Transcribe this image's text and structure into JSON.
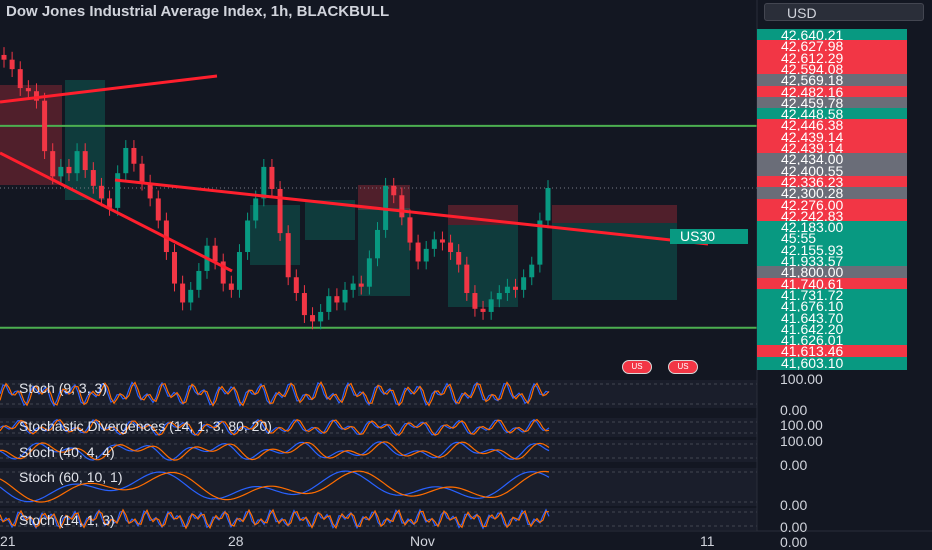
{
  "header": {
    "title": "Dow Jones Industrial Average Index, 1h, BLACKBULL",
    "currency": "USD"
  },
  "colors": {
    "background": "#131722",
    "up": "#089981",
    "down": "#f23645",
    "trendline": "#ff1f2d",
    "level": "#4caf50",
    "grey_tag": "#6a6d78"
  },
  "chart_data": {
    "type": "candlestick",
    "symbol_tag": "US30",
    "countdown": "45:55",
    "x_tick_labels": [
      "21",
      "28",
      "Nov",
      "11"
    ],
    "price_range": [
      41590,
      42700
    ],
    "price_close_series": [
      42590,
      42560,
      42500,
      42490,
      42460,
      42300,
      42220,
      42250,
      42230,
      42300,
      42240,
      42190,
      42150,
      42120,
      42230,
      42310,
      42260,
      42200,
      42150,
      42080,
      41980,
      41880,
      41820,
      41860,
      41920,
      42000,
      41950,
      41880,
      41860,
      41980,
      42080,
      42150,
      42250,
      42180,
      42040,
      41900,
      41850,
      41780,
      41760,
      41790,
      41840,
      41820,
      41860,
      41880,
      41870,
      41960,
      42050,
      42190,
      42160,
      42090,
      42010,
      41950,
      41990,
      42020,
      42010,
      41980,
      41940,
      41850,
      41800,
      41790,
      41830,
      41850,
      41870,
      41860,
      41900,
      41940,
      42080,
      42183
    ],
    "horizontal_levels": [
      42380,
      41740
    ],
    "price_tags": [
      {
        "label": "42,640.21",
        "color": "#089981"
      },
      {
        "label": "42,627.98",
        "color": "#f23645"
      },
      {
        "label": "42,612.29",
        "color": "#f23645"
      },
      {
        "label": "42,594.08",
        "color": "#f23645"
      },
      {
        "label": "42,569.18",
        "color": "#6a6d78"
      },
      {
        "label": "42,482.16",
        "color": "#f23645"
      },
      {
        "label": "42,459.78",
        "color": "#6a6d78"
      },
      {
        "label": "42,448.58",
        "color": "#089981"
      },
      {
        "label": "42,446.38",
        "color": "#f23645"
      },
      {
        "label": "42,439.14",
        "color": "#f23645"
      },
      {
        "label": "42,439.14",
        "color": "#f23645"
      },
      {
        "label": "42,434.00",
        "color": "#6a6d78"
      },
      {
        "label": "42,400.55",
        "color": "#6a6d78"
      },
      {
        "label": "42,336.23",
        "color": "#f23645"
      },
      {
        "label": "42,300.28",
        "color": "#6a6d78"
      },
      {
        "label": "42,276.00",
        "color": "#f23645"
      },
      {
        "label": "42,242.83",
        "color": "#f23645"
      },
      {
        "label": "42,183.00",
        "color": "#089981"
      },
      {
        "label": "45:55",
        "color": "#089981"
      },
      {
        "label": "42,155.93",
        "color": "#089981"
      },
      {
        "label": "41,933.57",
        "color": "#089981"
      },
      {
        "label": "41,800.00",
        "color": "#6a6d78"
      },
      {
        "label": "41,740.61",
        "color": "#f23645"
      },
      {
        "label": "41,731.72",
        "color": "#089981"
      },
      {
        "label": "41,676.10",
        "color": "#089981"
      },
      {
        "label": "41,643.70",
        "color": "#089981"
      },
      {
        "label": "41,642.20",
        "color": "#089981"
      },
      {
        "label": "41,626.01",
        "color": "#089981"
      },
      {
        "label": "41,613.46",
        "color": "#f23645"
      },
      {
        "label": "41,603.10",
        "color": "#089981"
      }
    ],
    "indicators": [
      {
        "label": "Stoch (9, 3, 3)",
        "ticks": [
          "100.00",
          "0.00"
        ]
      },
      {
        "label": "Stochastic Divergences (14, 1, 3, 80, 20)",
        "ticks": [
          "100.00"
        ]
      },
      {
        "label": "Stoch (40, 4, 4)",
        "ticks": [
          "100.00",
          "0.00"
        ]
      },
      {
        "label": "Stoch (60, 10, 1)",
        "ticks": [
          "0.00"
        ]
      },
      {
        "label": "Stoch (14, 1, 3)",
        "ticks": [
          "0.00",
          "0.00"
        ]
      }
    ]
  }
}
